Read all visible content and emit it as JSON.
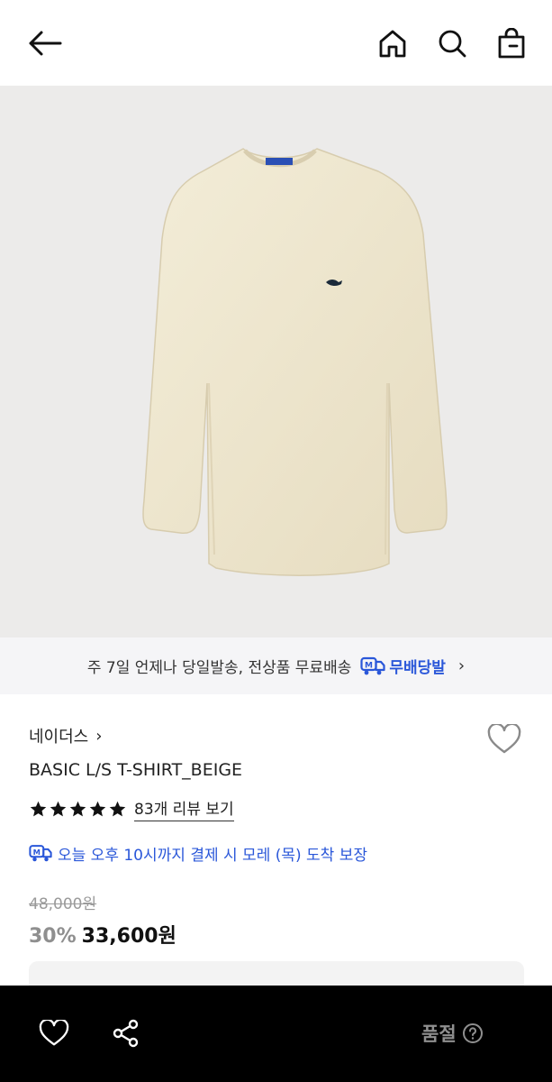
{
  "header": {
    "back_icon": "arrow-left-icon",
    "home_icon": "home-icon",
    "search_icon": "search-icon",
    "bag_icon": "shopping-bag-icon"
  },
  "product_image": {
    "subject": "beige long-sleeve t-shirt",
    "neck_label": "NEITHERS",
    "background": "#ecebea"
  },
  "delivery_banner": {
    "text": "주 7일 언제나 당일발송, 전상품 무료배송",
    "brand_label": "무배당발",
    "chevron": "›"
  },
  "product": {
    "brand": "네이더스",
    "brand_chevron": "›",
    "name": "BASIC L/S T-SHIRT_BEIGE",
    "rating_stars": 5,
    "review_link": "83개 리뷰 보기",
    "arrival_text": "오늘 오후 10시까지 결제 시 모레 (목) 도착 보장",
    "original_price": "48,000원",
    "discount": "30%",
    "sale_price": "33,600원"
  },
  "bottom_bar": {
    "heart_icon": "heart-icon",
    "share_icon": "share-icon",
    "status_label": "품절",
    "help_icon": "question-circle-icon"
  },
  "colors": {
    "accent_blue": "#2a57d9",
    "banner_bg": "#f5f5f7",
    "bottom_bar_bg": "#000000",
    "muted_gray": "#8f8f8f"
  }
}
